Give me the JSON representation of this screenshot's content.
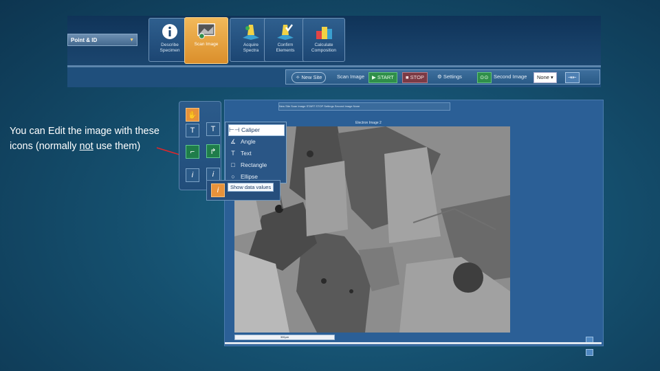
{
  "ribbon": {
    "workflow_selector": "Point & ID",
    "steps": [
      {
        "label_line1": "Describe",
        "label_line2": "Specimen",
        "icon": "info-icon"
      },
      {
        "label_line1": "Scan Image",
        "label_line2": "",
        "icon": "scan-image-icon",
        "active": true
      },
      {
        "label_line1": "Acquire",
        "label_line2": "Spectra",
        "icon": "acquire-spectra-icon"
      },
      {
        "label_line1": "Confirm",
        "label_line2": "Elements",
        "icon": "confirm-elements-icon"
      },
      {
        "label_line1": "Calculate",
        "label_line2": "Composition",
        "icon": "calculate-composition-icon"
      }
    ],
    "toolbar": {
      "new_site": "New Site",
      "scan_image": "Scan Image",
      "start": "START",
      "stop": "STOP",
      "settings": "Settings",
      "second_image": "Second Image",
      "second_image_value": "None"
    }
  },
  "annotation": {
    "text_before": "You can Edit the image with these icons (normally ",
    "emphasis": "not",
    "text_after": " use them)"
  },
  "menu": {
    "items": [
      {
        "label": "Caliper",
        "icon": "caliper-icon",
        "selected": true
      },
      {
        "label": "Angle",
        "icon": "angle-icon"
      },
      {
        "label": "Text",
        "icon": "text-icon"
      },
      {
        "label": "Rectangle",
        "icon": "rectangle-icon"
      },
      {
        "label": "Ellipse",
        "icon": "ellipse-icon"
      }
    ],
    "tooltip": "Show data values"
  },
  "window": {
    "image_title": "Electron Image 2",
    "scale_label": "300µm",
    "mini_toolbar": "New Site   Scan Image   START   STOP   Settings   Second Image  None"
  },
  "colors": {
    "accent_orange": "#e8923a",
    "start_green": "#2f8f4a",
    "stop_red": "#7b3a45"
  }
}
